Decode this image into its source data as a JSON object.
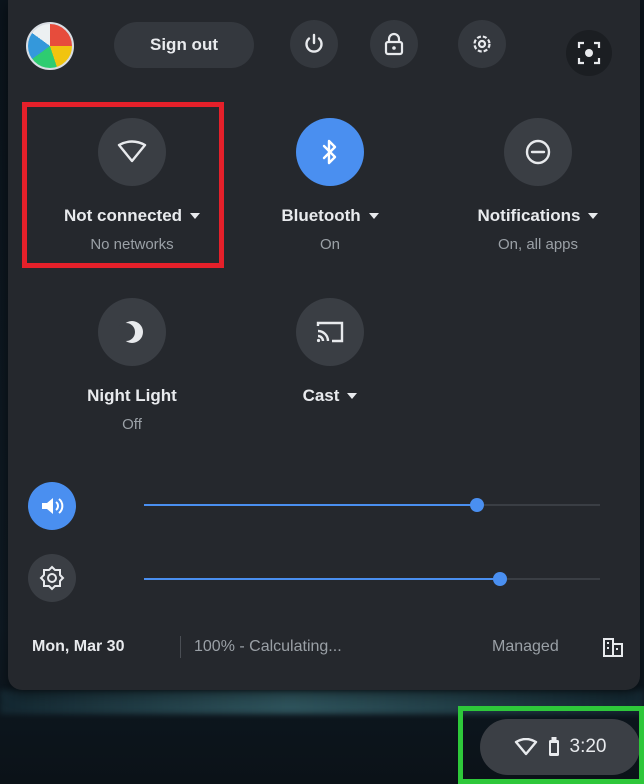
{
  "top_bar": {
    "signout_label": "Sign out",
    "icons": [
      "avatar",
      "power-icon",
      "lock-icon",
      "settings-icon",
      "screen-capture-icon"
    ]
  },
  "pods": [
    {
      "label": "Not connected",
      "sub": "No networks",
      "icon": "wifi-icon",
      "on": false,
      "has_menu": true
    },
    {
      "label": "Bluetooth",
      "sub": "On",
      "icon": "bluetooth-icon",
      "on": true,
      "has_menu": true
    },
    {
      "label": "Notifications",
      "sub": "On, all apps",
      "icon": "do-not-disturb-icon",
      "on": false,
      "has_menu": true
    },
    {
      "label": "Night Light",
      "sub": "Off",
      "icon": "night-light-icon",
      "on": false,
      "has_menu": false
    },
    {
      "label": "Cast",
      "sub": "",
      "icon": "cast-icon",
      "on": false,
      "has_menu": true
    }
  ],
  "sliders": {
    "volume": {
      "icon": "volume-icon",
      "value_percent": 73
    },
    "brightness": {
      "icon": "brightness-icon",
      "value_percent": 78
    }
  },
  "footer": {
    "date": "Mon, Mar 30",
    "battery": "100% - Calculating...",
    "managed": "Managed"
  },
  "shelf": {
    "time": "3:20"
  },
  "colors": {
    "accent": "#4a8ff0",
    "panel": "#25282d",
    "highlight_red": "#e5202a",
    "highlight_green": "#2ec83a"
  }
}
